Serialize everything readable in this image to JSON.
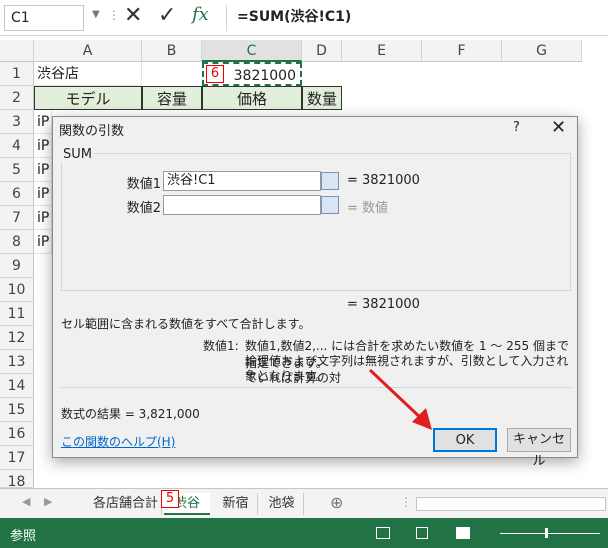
{
  "formula_bar": {
    "name_box": "C1",
    "fx": "fx",
    "formula": "=SUM(渋谷!C1)"
  },
  "columns": [
    "A",
    "B",
    "C",
    "D",
    "E",
    "F",
    "G"
  ],
  "rows": [
    "1",
    "2",
    "3",
    "4",
    "5",
    "6",
    "7",
    "8",
    "9",
    "10",
    "11",
    "12",
    "13",
    "14",
    "15",
    "16",
    "17",
    "18"
  ],
  "cells": {
    "a1": "渋谷店",
    "c1": "3821000",
    "a2": "モデル",
    "b2": "容量",
    "c2": "価格",
    "d2": "数量",
    "a_partial": "iP"
  },
  "annotations": {
    "badge_c1": "6",
    "badge_tab": "5"
  },
  "dialog": {
    "title": "関数の引数",
    "help": "?",
    "close": "✕",
    "function_name": "SUM",
    "arg1_label": "数値1",
    "arg1_value": "渋谷!C1",
    "arg1_result": "=  3821000",
    "arg2_label": "数値2",
    "arg2_value": "",
    "arg2_result": "=  数値",
    "total_result": "=  3821000",
    "description": "セル範囲に含まれる数値をすべて合計します。",
    "param_name": "数値1:",
    "param_desc_1": "数値1,数値2,... には合計を求めたい数値を 1 ～ 255 個まで指定できます。",
    "param_desc_2": "論理値および文字列は無視されますが、引数として入力されていれば計算の対",
    "param_desc_3": "象となります。",
    "formula_result": "数式の結果 =  3,821,000",
    "help_link": "この関数のヘルプ(H)",
    "ok_label": "OK",
    "cancel_label": "キャンセル"
  },
  "sheet_tabs": [
    "各店舗合計",
    "渋谷",
    "新宿",
    "池袋"
  ],
  "active_tab": "渋谷",
  "status": {
    "mode": "参照"
  },
  "colors": {
    "excel_green": "#217346",
    "header_fill": "#e2efda",
    "annotation_red": "#e00000",
    "arrow_red": "#e02020"
  }
}
